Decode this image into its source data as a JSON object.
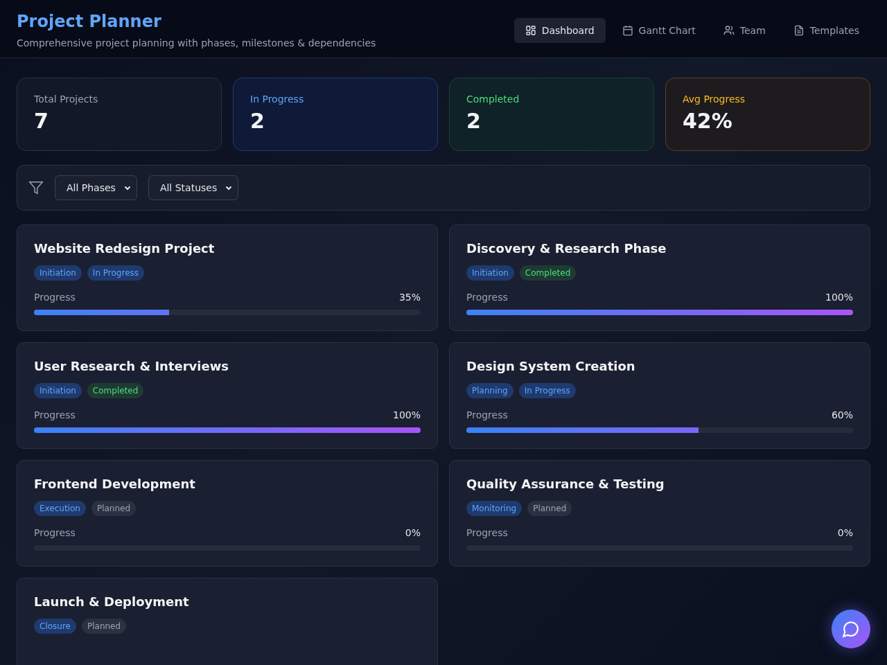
{
  "header": {
    "title": "Project Planner",
    "subtitle": "Comprehensive project planning with phases, milestones & dependencies"
  },
  "nav": [
    {
      "label": "Dashboard",
      "selected": true
    },
    {
      "label": "Gantt Chart",
      "selected": false
    },
    {
      "label": "Team",
      "selected": false
    },
    {
      "label": "Templates",
      "selected": false
    }
  ],
  "stats": [
    {
      "label": "Total Projects",
      "value": "7",
      "kind": "neutral"
    },
    {
      "label": "In Progress",
      "value": "2",
      "kind": "blue"
    },
    {
      "label": "Completed",
      "value": "2",
      "kind": "green"
    },
    {
      "label": "Avg Progress",
      "value": "42%",
      "kind": "amber"
    }
  ],
  "filters": [
    {
      "value": "All Phases"
    },
    {
      "value": "All Statuses"
    }
  ],
  "projects": [
    {
      "title": "Website Redesign Project",
      "phase": "Initiation",
      "status": {
        "label": "In Progress",
        "kind": "active"
      },
      "progress_label": "Progress",
      "reading": "35%",
      "level": 0.35
    },
    {
      "title": "Discovery & Research Phase",
      "phase": "Initiation",
      "status": {
        "label": "Completed",
        "kind": "done"
      },
      "progress_label": "Progress",
      "reading": "100%",
      "level": 1
    },
    {
      "title": "User Research & Interviews",
      "phase": "Initiation",
      "status": {
        "label": "Completed",
        "kind": "done"
      },
      "progress_label": "Progress",
      "reading": "100%",
      "level": 1
    },
    {
      "title": "Design System Creation",
      "phase": "Planning",
      "status": {
        "label": "In Progress",
        "kind": "active"
      },
      "progress_label": "Progress",
      "reading": "60%",
      "level": 0.6
    },
    {
      "title": "Frontend Development",
      "phase": "Execution",
      "status": {
        "label": "Planned",
        "kind": "planned"
      },
      "progress_label": "Progress",
      "reading": "0%",
      "level": 0
    },
    {
      "title": "Quality Assurance & Testing",
      "phase": "Monitoring",
      "status": {
        "label": "Planned",
        "kind": "planned"
      },
      "progress_label": "Progress",
      "reading": "0%",
      "level": 0
    },
    {
      "title": "Launch & Deployment",
      "phase": "Closure",
      "status": {
        "label": "Planned",
        "kind": "planned"
      }
    }
  ]
}
